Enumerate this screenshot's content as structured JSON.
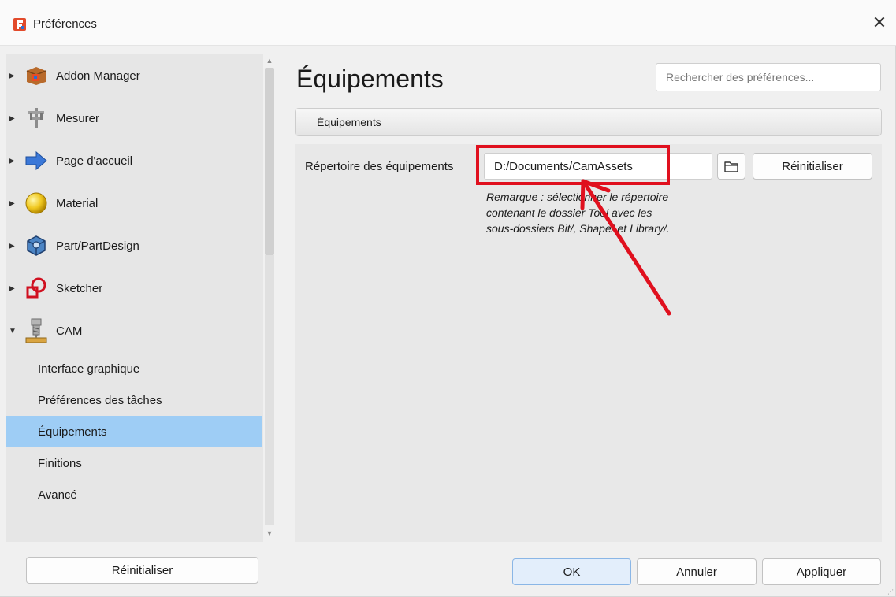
{
  "window": {
    "title": "Préférences",
    "close_label": "✕"
  },
  "sidebar": {
    "items": [
      {
        "label": "Addon Manager",
        "expanded": false,
        "icon": "addon-manager-icon"
      },
      {
        "label": "Mesurer",
        "expanded": false,
        "icon": "measure-icon"
      },
      {
        "label": "Page d'accueil",
        "expanded": false,
        "icon": "arrow-right-icon"
      },
      {
        "label": "Material",
        "expanded": false,
        "icon": "material-sphere-icon"
      },
      {
        "label": "Part/PartDesign",
        "expanded": false,
        "icon": "part-design-icon"
      },
      {
        "label": "Sketcher",
        "expanded": false,
        "icon": "sketcher-icon"
      },
      {
        "label": "CAM",
        "expanded": true,
        "icon": "cam-icon"
      }
    ],
    "subitems": [
      {
        "label": "Interface graphique"
      },
      {
        "label": "Préférences des tâches"
      },
      {
        "label": "Équipements",
        "selected": true
      },
      {
        "label": "Finitions"
      },
      {
        "label": "Avancé"
      }
    ],
    "reset_label": "Réinitialiser"
  },
  "main": {
    "title": "Équipements",
    "search_placeholder": "Rechercher des préférences...",
    "group_title": "Équipements",
    "field_label": "Répertoire des équipements",
    "field_value": "D:/Documents/CamAssets",
    "reset_label": "Réinitialiser",
    "note": "Remarque : sélectionner le répertoire\ncontenant le dossier Tool avec les\nsous-dossiers Bit/, Shape/ et Library/."
  },
  "footer": {
    "ok": "OK",
    "cancel": "Annuler",
    "apply": "Appliquer"
  },
  "colors": {
    "selection": "#9ecdf5",
    "highlight": "#e0101e",
    "primary_button": "#e3eefb"
  }
}
